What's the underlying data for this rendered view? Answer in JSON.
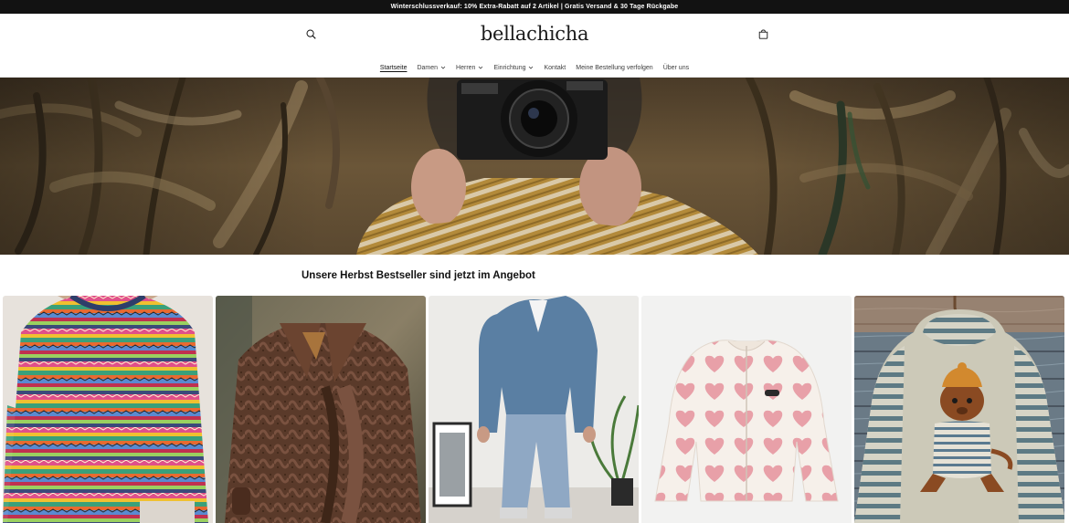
{
  "announcement": "Winterschlussverkauf: 10% Extra-Rabatt auf 2 Artikel | Gratis Versand & 30 Tage Rückgabe",
  "header": {
    "logo": "bellachicha",
    "icons": {
      "search": "search-icon",
      "cart": "shopping-bag-icon"
    }
  },
  "nav": {
    "items": [
      {
        "label": "Startseite",
        "active": true,
        "dropdown": false
      },
      {
        "label": "Damen",
        "active": false,
        "dropdown": true
      },
      {
        "label": "Herren",
        "active": false,
        "dropdown": true
      },
      {
        "label": "Einrichtung",
        "active": false,
        "dropdown": true
      },
      {
        "label": "Kontakt",
        "active": false,
        "dropdown": false
      },
      {
        "label": "Meine Bestellung verfolgen",
        "active": false,
        "dropdown": false
      },
      {
        "label": "Über uns",
        "active": false,
        "dropdown": false
      }
    ]
  },
  "section": {
    "title": "Unsere Herbst Bestseller sind jetzt im Angebot"
  },
  "colors": {
    "announcement_bg": "#121212",
    "text": "#121212"
  }
}
